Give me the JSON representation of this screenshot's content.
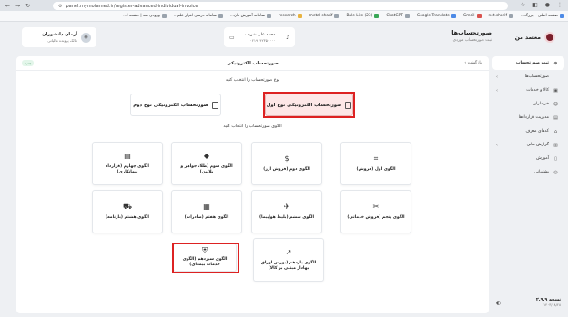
{
  "browser": {
    "url": "panel.mymotamed.ir/register-advanced-individual-invoice",
    "bookmarks": [
      {
        "label": "صفحه اصلی - بازرگ...",
        "color": "blue"
      },
      {
        "label": "net.sharif",
        "color": "grey"
      },
      {
        "label": "Gmail",
        "color": "red"
      },
      {
        "label": "Google Translate",
        "color": "blue"
      },
      {
        "label": "ChatGPT",
        "color": "grey"
      },
      {
        "label": "Bale Lite (23)",
        "color": "green"
      },
      {
        "label": "metal sharif",
        "color": "grey"
      },
      {
        "label": "research",
        "color": "yellow"
      },
      {
        "label": "سامانه آموزش دان...",
        "color": "grey"
      },
      {
        "label": "سامانه درسی افزار علم...",
        "color": "grey"
      },
      {
        "label": "ورودی سه | صفحه ا...",
        "color": "grey"
      }
    ]
  },
  "app": {
    "brand": "معتمد من",
    "page_title": "صورتحساب‌ها",
    "page_subtitle": "ثبت صورتحساب موردی",
    "company_name": "محمد علی شریف",
    "company_code": "۰۲۱۹۰۴۲۳۵۰۰۰۰",
    "user_name": "آرمان دانشوران",
    "user_role": "مالک پرونده مالیاتی"
  },
  "sidebar": {
    "items": [
      {
        "label": "ثبت صورتحساب",
        "icon": "plus-circle-icon",
        "active": true,
        "chevron": false
      },
      {
        "label": "صورتحساب‌ها",
        "icon": "",
        "active": false,
        "chevron": true
      },
      {
        "label": "کالا و خدمات",
        "icon": "box-icon",
        "active": false,
        "chevron": true
      },
      {
        "label": "خریداران",
        "icon": "users-icon",
        "active": false,
        "chevron": false
      },
      {
        "label": "مدیریت قراردادها",
        "icon": "contract-icon",
        "active": false,
        "chevron": false
      },
      {
        "label": "کدهای معرف",
        "icon": "tag-icon",
        "active": false,
        "chevron": false
      },
      {
        "label": "گزارش‌ مالی",
        "icon": "chart-icon",
        "active": false,
        "chevron": true
      },
      {
        "label": "آموزش",
        "icon": "book-icon",
        "active": false,
        "chevron": false
      },
      {
        "label": "پشتیبانی",
        "icon": "support-icon",
        "active": false,
        "chevron": false
      }
    ],
    "version": "نسخه ۲.۹.۹",
    "version_date": "۱۴۰۳/۰۸/۲۸"
  },
  "card": {
    "title": "صورتحساب الکترونیکی",
    "back": "بازگشت",
    "badge": "جدید",
    "type_prompt": "نوع صورتحساب را انتخاب کنید",
    "type1": "صورتحساب الکترونیکی نوع اول",
    "type2": "صورتحساب الکترونیکی نوع دوم",
    "pattern_prompt": "الگوی صورتحساب را انتخاب کنید"
  },
  "patterns": [
    {
      "label": "الگوی اول (فروش)",
      "icon": "scan-icon"
    },
    {
      "label": "الگوی دوم (فروش ارز)",
      "icon": "currency-icon"
    },
    {
      "label": "الگوی سوم (طلا، جواهر و پلاتین)",
      "icon": "diamond-icon"
    },
    {
      "label": "الگوی چهارم (قرارداد پیمانکاری)",
      "icon": "document-icon"
    },
    {
      "label": "الگوی پنجم (فروش خدماتی)",
      "icon": "service-icon"
    },
    {
      "label": "الگوی ششم (بلیط هواپیما)",
      "icon": "plane-icon"
    },
    {
      "label": "الگوی هفتم (صادرات)",
      "icon": "package-icon"
    },
    {
      "label": "الگوی هشتم (بارنامه)",
      "icon": "truck-icon"
    },
    {
      "label": "الگوی یازدهم (بورس اوراق بهادار مبتنی بر کالا)",
      "icon": "trend-icon"
    },
    {
      "label": "الگوی سیزدهم (الگوی خدمات بیمه‌ای)",
      "icon": "shield-icon"
    }
  ]
}
